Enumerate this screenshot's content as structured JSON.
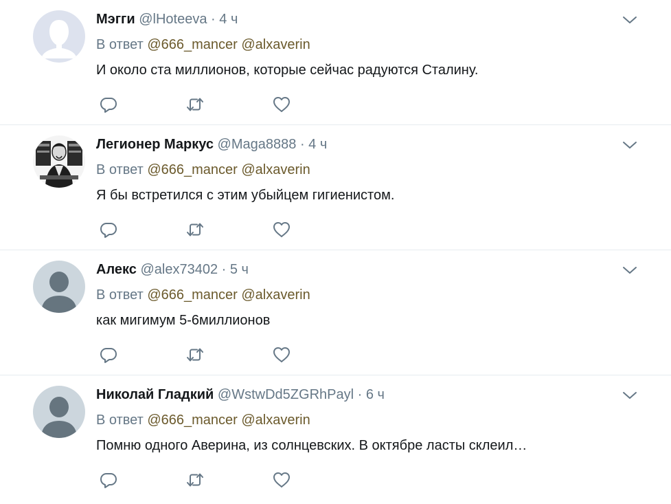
{
  "colors": {
    "name": "#14171a",
    "meta": "#657786",
    "mention": "#6b5a2c",
    "divider": "#e6ecf0",
    "default_avatar_bg": "#ccd6dd",
    "default_avatar_fg": "#66757f"
  },
  "icons": {
    "reply": "reply-icon",
    "retweet": "retweet-icon",
    "like": "like-icon",
    "caret": "chevron-down-icon"
  },
  "tweets": [
    {
      "name": "Мэгги",
      "handle": "@lHoteeva",
      "separator": "·",
      "time": "4 ч",
      "reply_prefix": "В ответ",
      "mention_1": "@666_mancer",
      "mention_2": "@alxaverin",
      "text": "И около ста миллионов, которые сейчас радуются Сталину.",
      "avatar": "default-egg-avatar"
    },
    {
      "name": "Легионер Маркус",
      "handle": "@Maga8888",
      "separator": "·",
      "time": "4 ч",
      "reply_prefix": "В ответ",
      "mention_1": "@666_mancer",
      "mention_2": "@alxaverin",
      "text": "Я бы встретился с этим убыйцем гигиенистом.",
      "avatar": "photo-avatar"
    },
    {
      "name": "Алекс",
      "handle": "@alex73402",
      "separator": "·",
      "time": "5 ч",
      "reply_prefix": "В ответ",
      "mention_1": "@666_mancer",
      "mention_2": "@alxaverin",
      "text": "как мигимум 5-6миллионов",
      "avatar": "default-avatar"
    },
    {
      "name": "Николай Гладкий",
      "handle": "@WstwDd5ZGRhPayl",
      "separator": "·",
      "time": "6 ч",
      "reply_prefix": "В ответ",
      "mention_1": "@666_mancer",
      "mention_2": "@alxaverin",
      "text": "Помню одного Аверина, из солнцевских. В октябре ласты склеил…",
      "avatar": "default-avatar"
    }
  ]
}
